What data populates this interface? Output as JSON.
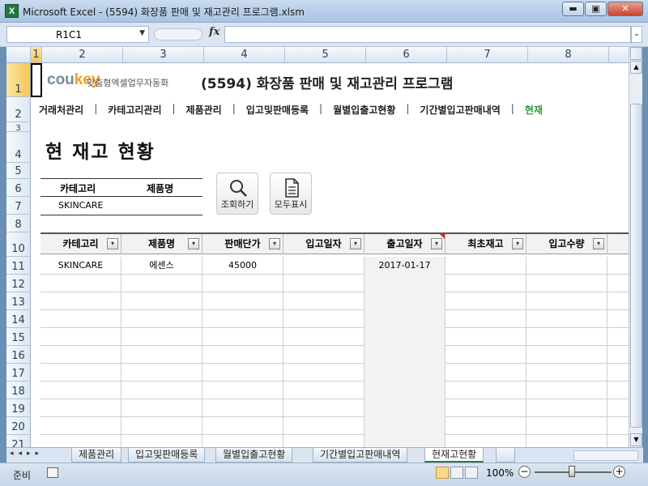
{
  "window": {
    "app_icon": "X",
    "title": "Microsoft Excel - (5594) 화장품 판매 및 재고관리 프로그램.xlsm",
    "minimize": "▬",
    "maximize": "▣",
    "close": "✕"
  },
  "formula_bar": {
    "name_box": "R1C1",
    "fx": "fx",
    "value": ""
  },
  "columns": [
    "1",
    "2",
    "3",
    "4",
    "5",
    "6",
    "7",
    "8"
  ],
  "rows": [
    "1",
    "2",
    "3",
    "4",
    "5",
    "6",
    "7",
    "8",
    "10",
    "11",
    "12",
    "13",
    "14",
    "15",
    "16",
    "17",
    "18",
    "19",
    "20",
    "21"
  ],
  "header": {
    "logo_main": "cou",
    "logo_key": "key",
    "logo_sub": "맞춤형엑셀업무자동화",
    "app_title": "(5594) 화장품 판매 및 재고관리 프로그램"
  },
  "menu": [
    "거래처관리",
    "카테고리관리",
    "제품관리",
    "입고및판매등록",
    "월별입출고현황",
    "기간별입고판매내역",
    "현재"
  ],
  "menu_sep": "|",
  "page_title": "현 재고 현황",
  "filter": {
    "category_label": "카테고리",
    "product_label": "제품명",
    "category_value": "SKINCARE",
    "product_value": ""
  },
  "buttons": {
    "search": "조회하기",
    "show_all": "모두표시"
  },
  "table": {
    "headers": [
      "카테고리",
      "제품명",
      "판매단가",
      "입고일자",
      "출고일자",
      "최초재고",
      "입고수량"
    ],
    "filter_glyph": "▾",
    "rows": [
      [
        "SKINCARE",
        "에센스",
        "45000",
        "",
        "2017-01-17",
        "",
        ""
      ]
    ]
  },
  "sheet_tabs": [
    "제품관리",
    "입고및판매등록",
    "월별입출고현황",
    "기간별입고판매내역",
    "현재고현황"
  ],
  "active_tab": "현재고현황",
  "tab_nav": "◂◂▸▸",
  "status": {
    "ready": "준비",
    "zoom": "100%",
    "zoom_minus": "−",
    "zoom_plus": "+"
  }
}
